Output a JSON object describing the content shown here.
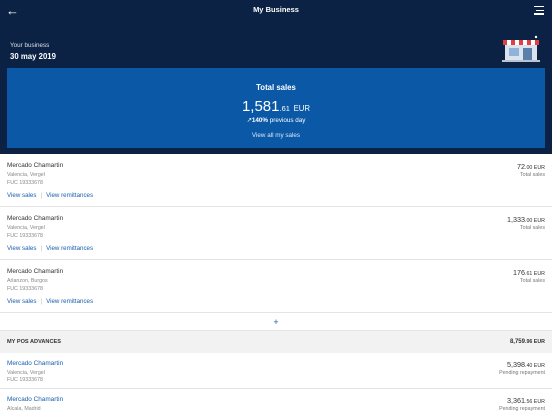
{
  "header": {
    "title": "My Business"
  },
  "hero": {
    "label": "Your business",
    "date": "30 may 2019"
  },
  "sales_card": {
    "title": "Total sales",
    "amount_int": "1,581",
    "amount_dec": ".61",
    "currency": "EUR",
    "change_pct": "140%",
    "change_text": "previous day",
    "link": "View all my sales"
  },
  "sales_rows": [
    {
      "name": "Mercado Chamartin",
      "address": "Valencia, Vergel",
      "fuc": "FUC 19333678",
      "amount_int": "72",
      "amount_dec": ".00 EUR",
      "caption": "Total sales",
      "link_sales": "View sales",
      "link_remit": "View remittances"
    },
    {
      "name": "Mercado Chamartin",
      "address": "Valencia, Vergel",
      "fuc": "FUC 19333678",
      "amount_int": "1,333",
      "amount_dec": ".00 EUR",
      "caption": "Total sales",
      "link_sales": "View sales",
      "link_remit": "View remittances"
    },
    {
      "name": "Mercado Chamartin",
      "address": "Arlanzon, Burgos",
      "fuc": "FUC 19333678",
      "amount_int": "176",
      "amount_dec": ".61 EUR",
      "caption": "Total sales",
      "link_sales": "View sales",
      "link_remit": "View remittances"
    }
  ],
  "add_symbol": "+",
  "advances": {
    "label": "MY POS ADVANCES",
    "total_int": "8,759",
    "total_dec": ".96 EUR",
    "items": [
      {
        "name": "Mercado Chamartin",
        "address": "Valencia, Vergel",
        "fuc": "FUC 19333678",
        "amount_int": "5,398",
        "amount_dec": ".40 EUR",
        "caption": "Pending repayment"
      },
      {
        "name": "Mercado Chamartin",
        "address": "Alcala, Madrid",
        "fuc": "",
        "amount_int": "3,361",
        "amount_dec": ".56 EUR",
        "caption": "Pending repayment"
      }
    ]
  },
  "colors": {
    "navy": "#0b2244",
    "card_blue": "#0b58a7",
    "link_blue": "#1a5fae"
  },
  "icons": {
    "back": "arrow-left-icon",
    "menu": "menu-icon",
    "store": "store-icon",
    "trend": "arrow-up-right-icon"
  }
}
